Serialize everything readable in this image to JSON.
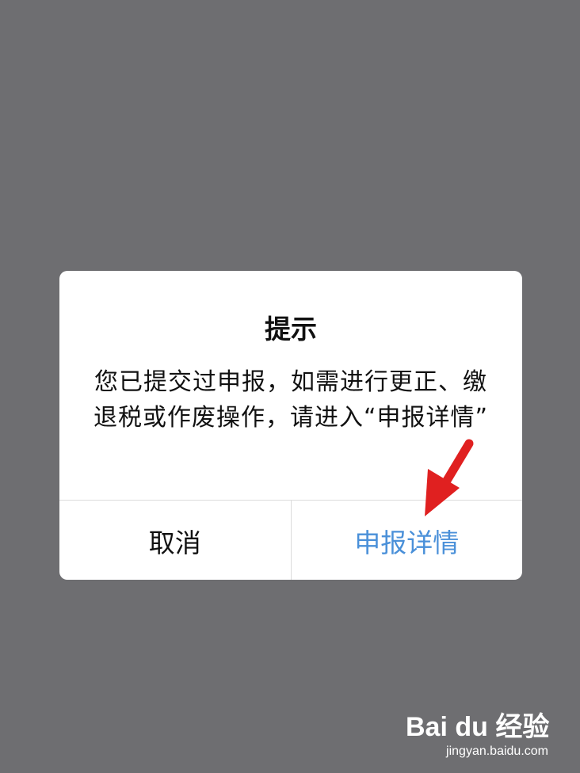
{
  "dialog": {
    "title": "提示",
    "message": "您已提交过申报，如需进行更正、缴退税或作废操作，请进入“申报详情”",
    "cancel_label": "取消",
    "confirm_label": "申报详情"
  },
  "colors": {
    "backdrop": "#6e6e71",
    "confirm_text": "#4a90d9",
    "arrow": "#e02020"
  },
  "icons": {
    "annotation_arrow": "red-arrow-icon",
    "watermark_paw": "paw-icon"
  },
  "watermark": {
    "brand": "Bai du 经验",
    "url": "jingyan.baidu.com"
  }
}
